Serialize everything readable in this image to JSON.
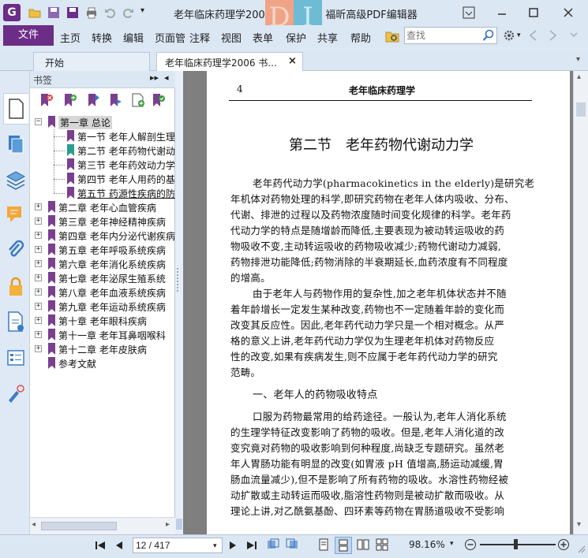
{
  "app": {
    "icon_letter": "G",
    "window_title": "老年临床药理学2006 书签.pdf - 福昕高级PDF编辑器"
  },
  "menu": {
    "file": "文件",
    "items": [
      "主页",
      "转换",
      "编辑",
      "页面管",
      "注释",
      "视图",
      "表单",
      "保护",
      "共享",
      "帮助"
    ]
  },
  "search": {
    "placeholder": "查找"
  },
  "tabs": [
    {
      "label": "开始"
    },
    {
      "label": "老年临床药理学2006 书...",
      "close": "×"
    }
  ],
  "bookmarks": {
    "title": "书签",
    "tree": [
      {
        "label": "第一章  总论",
        "level": 0,
        "expanded": true,
        "selected": true
      },
      {
        "label": "第一节  老年人解剖生理",
        "level": 1
      },
      {
        "label": "第二节  老年药物代谢动",
        "level": 1,
        "current": true
      },
      {
        "label": "第三节  老年药效动力学",
        "level": 1
      },
      {
        "label": "第四节  老年人用药的基",
        "level": 1
      },
      {
        "label": "第五节  药源性疾病的防",
        "level": 1,
        "underlined": true
      },
      {
        "label": "第二章  老年心血管疾病",
        "level": 0
      },
      {
        "label": "第三章  老年神经精神疾病",
        "level": 0
      },
      {
        "label": "第四章  老年内分泌代谢疾病",
        "level": 0
      },
      {
        "label": "第五章  老年呼吸系统疾病",
        "level": 0
      },
      {
        "label": "第六章  老年消化系统疾病",
        "level": 0
      },
      {
        "label": "第七章  老年泌尿生殖系统",
        "level": 0
      },
      {
        "label": "第八章  老年血液系统疾病",
        "level": 0
      },
      {
        "label": "第九章  老年运动系统疾病",
        "level": 0
      },
      {
        "label": "第十章  老年眼科疾病",
        "level": 0
      },
      {
        "label": "第十一章  老年耳鼻咽喉科",
        "level": 0
      },
      {
        "label": "第十二章  老年皮肤病",
        "level": 0
      },
      {
        "label": "参考文献",
        "level": 0,
        "leaf": true
      }
    ]
  },
  "document": {
    "page_number": "4",
    "running_header": "老年临床药理学",
    "section_title": "第二节　老年药物代谢动力学",
    "paragraphs": [
      [
        "老年药代动力学(pharmacokinetics in the elderly)是研究老",
        "年机体对药物处理的科学,即研究药物在老年人体内吸收、分布、",
        "代谢、排泄的过程以及药物浓度随时间变化规律的科学。老年药",
        "代动力学的特点是随增龄而降低,主要表现为被动转运吸收的药",
        "物吸收不变,主动转运吸收的药物吸收减少;药物代谢动力减弱,",
        "药物排泄功能降低;药物消除的半衰期延长,血药浓度有不同程度",
        "的增高。"
      ],
      [
        "由于老年人与药物作用的复杂性,加之老年机体状态并不随",
        "着年龄增长一定发生某种改变,药物也不一定随着年龄的变化而",
        "改变其反应性。因此,老年药代动力学只是一个相对概念。从严",
        "格的意义上讲,老年药代动力学仅为生理老年机体对药物反应",
        "性的改变,如果有疾病发生,则不应属于老年药代动力学的研究",
        "范畴。"
      ]
    ],
    "subheading": "一、老年人的药物吸收特点",
    "paragraph3": [
      "口服为药物最常用的给药途径。一般认为,老年人消化系统",
      "的生理学特征改变影响了药物的吸收。但是,老年人消化道的改",
      "变究竟对药物的吸收影响到何种程度,尚缺乏专题研究。虽然老",
      "年人胃肠功能有明显的改变(如胃液 pH 值增高,肠运动减缓,胃",
      "肠血流量减少),但不是影响了所有药物的吸收。水溶性药物经被",
      "动扩散或主动转运而吸收,脂溶性药物则是被动扩散而吸收。从",
      "理论上讲,对乙酰氨基酚、四环素等药物在胃肠道吸收不受影响"
    ]
  },
  "status": {
    "page_indicator": "12 / 417",
    "zoom": "98.16%"
  },
  "colors": {
    "brand": "#6b2d85",
    "panel": "#dce7f4",
    "bookmark_flag": "#7b3f8f",
    "current_flag": "#2a9d8f"
  }
}
